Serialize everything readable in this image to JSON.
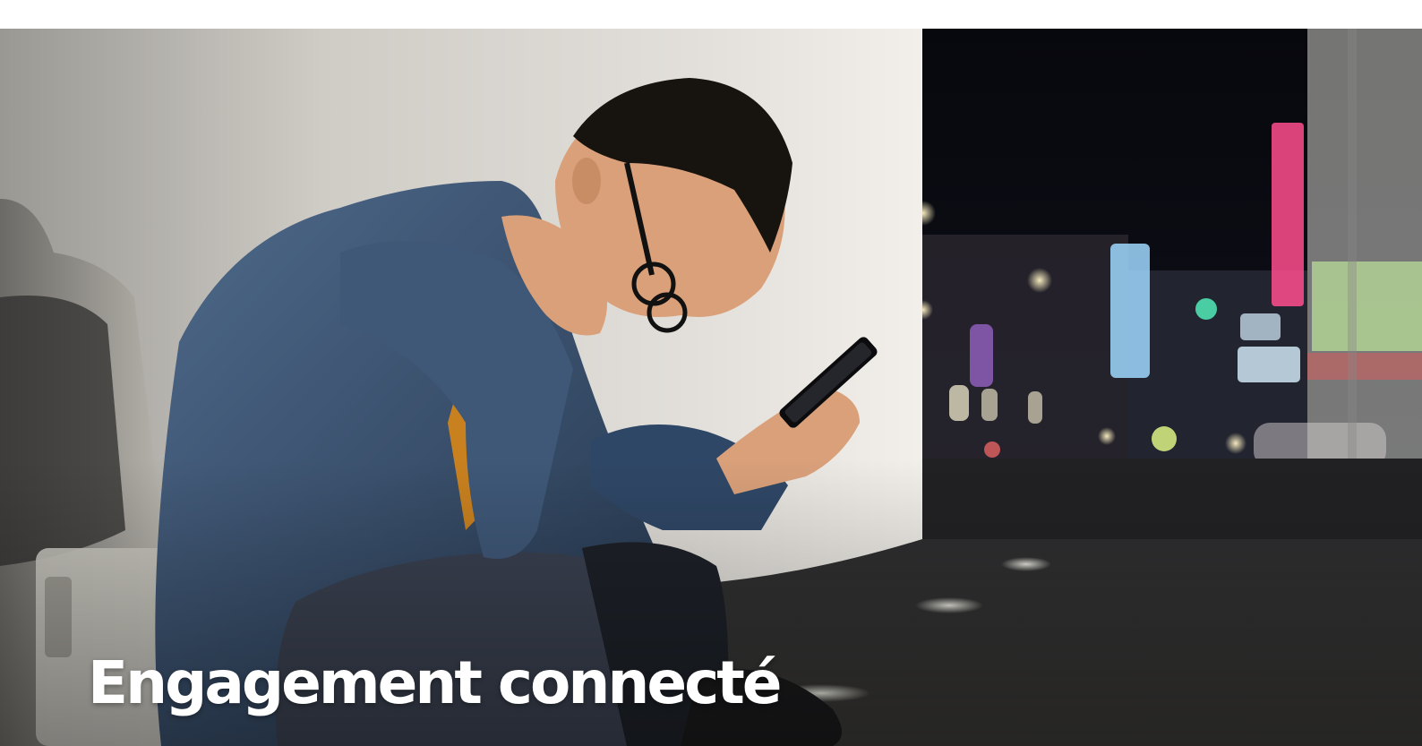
{
  "hero": {
    "title": "Engagement connecté",
    "image_description": "night-city-phone-photo"
  },
  "colors": {
    "page_background": "#ffffff",
    "title_text": "#ffffff",
    "wall": "#d8d5d0",
    "street_night": "#0f1018",
    "neon_pink": "#ff4d8d",
    "neon_blue": "#9fd8ff",
    "neon_green": "#c9f7a0"
  }
}
